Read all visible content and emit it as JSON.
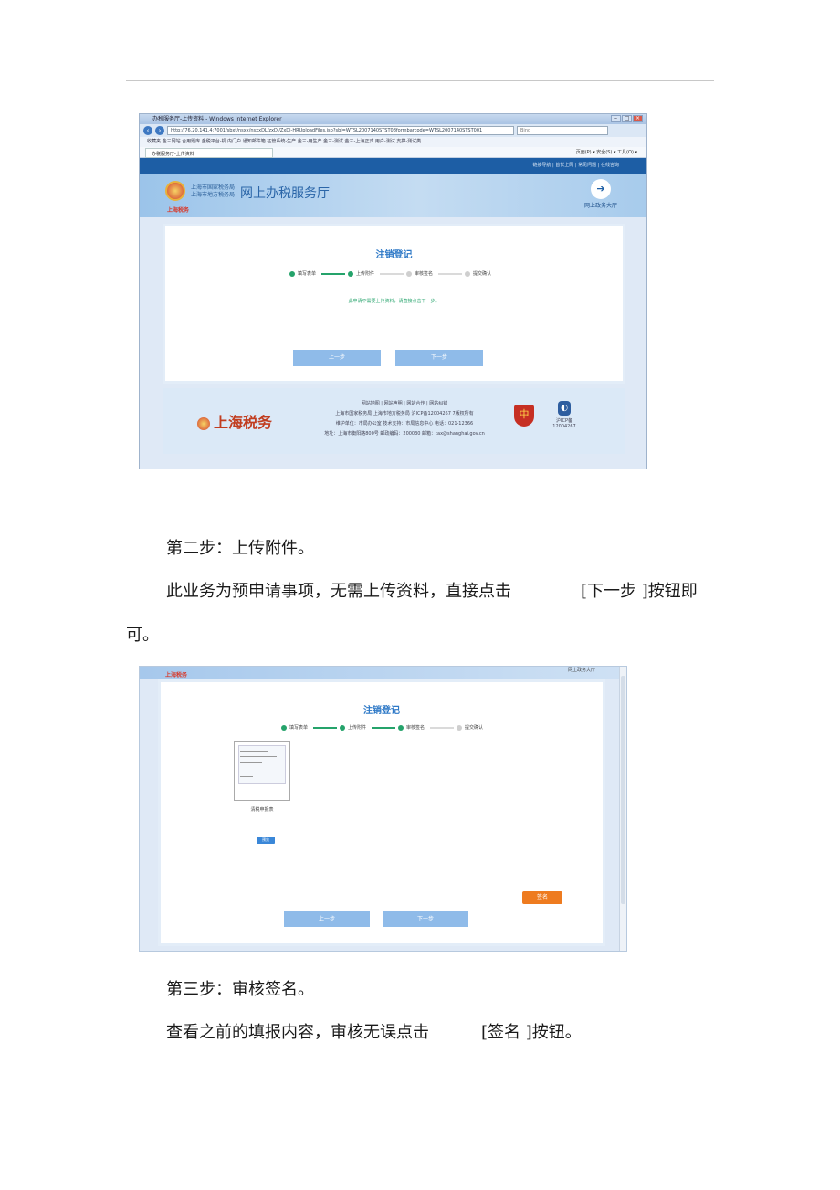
{
  "shot1": {
    "window_title": "办税服务厅-上传资料 - Windows Internet Explorer",
    "url": "http://76.20.141.4:7001/sbxt/nsxx/nsxxDL/zxDl/ZxDl-HRUploadFiles.jsp?sbl=WTSL2007140STST08formbarcode=WTSL2007140STST001",
    "search_placeholder": "Bing",
    "favorites_bar": "收藏夹   金三网站  合用题库  金税平台-机  内门户  通知邮件箱  征管系统-生产  金三-用生产  金三-测试  金三-上海正式  用户-测试  支撑-测试类",
    "tab_label": "办税服务厅-上传资料",
    "command_bar": "页面(P) ▾   安全(S) ▾   工具(O) ▾",
    "top_links": "链接导航  |  首长上网  |  常见问题  |  在线咨询",
    "logo_line1": "上海市国家税务局",
    "logo_line2": "上海市地方税务局",
    "logo_main": "网上办税服务厅",
    "logo_red": "上海税务",
    "hall_button": "网上政务大厅",
    "form_title": "注销登记",
    "steps": [
      "填写表单",
      "上传附件",
      "审核签名",
      "提交确认"
    ],
    "notice": "此申请不需要上传资料，请直接点击下一步。",
    "prev_btn": "上一步",
    "next_btn": "下一步",
    "footer_logo": "上海税务",
    "footer_links": "网站地图  |  网站声明  |  网站合作  |  网站纠错",
    "footer_line2": "上海市国家税务局 上海市地方税务局 沪ICP备12004267 7版权所有",
    "footer_line3": "维护单位：市局办公室   技术支持：市局信息中心  电话：021-12366",
    "footer_line4": "地址：上海市衡阳路800号   邮政编码：200030   邮箱：tax@shanghai.gov.cn",
    "icp_label": "沪ICP备",
    "icp_number": "12004267"
  },
  "para1": "第二步：上传附件。",
  "para2a": "此业务为预申请事项，无需上传资料，直接点击",
  "para2b": "[下一步 ]按钮即",
  "para2c": "可。",
  "shot2": {
    "red_label": "上海税务",
    "top_right": "网上政务大厅",
    "form_title": "注销登记",
    "steps": [
      "填写表单",
      "上传附件",
      "审核签名",
      "提交确认"
    ],
    "thumb_caption": "清税申报表",
    "preview_btn": "预览",
    "sign_btn": "签名",
    "prev_btn": "上一步",
    "next_btn": "下一步"
  },
  "para3": "第三步：审核签名。",
  "para4a": "查看之前的填报内容，审核无误点击",
  "para4b": "[签名 ]按钮。",
  "colors": {
    "accent_blue": "#2e79c7",
    "step_green": "#25a36b",
    "sign_orange": "#ee7b1f"
  }
}
